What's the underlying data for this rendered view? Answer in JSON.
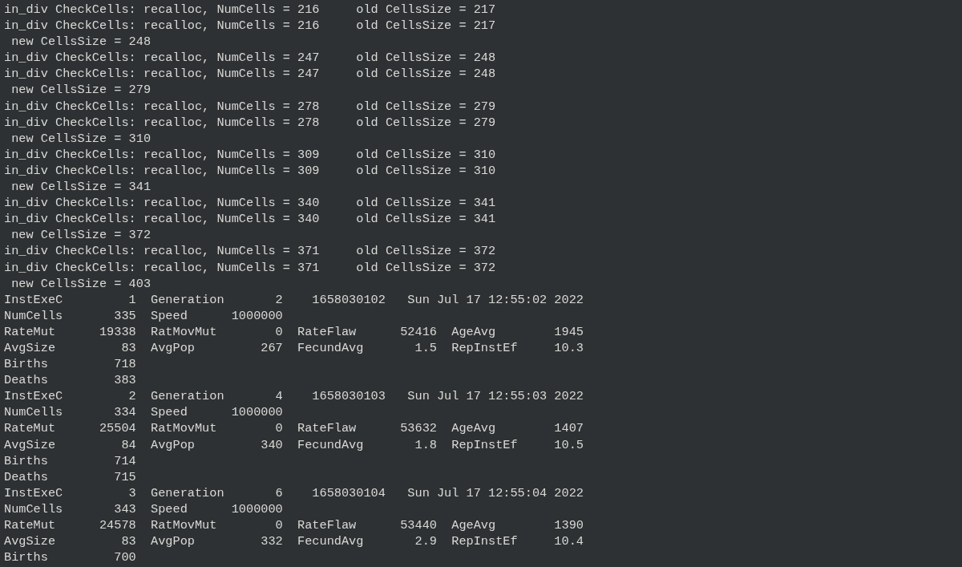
{
  "terminal": {
    "lines": [
      "in_div CheckCells: recalloc, NumCells = 216     old CellsSize = 217",
      "in_div CheckCells: recalloc, NumCells = 216     old CellsSize = 217",
      " new CellsSize = 248",
      "in_div CheckCells: recalloc, NumCells = 247     old CellsSize = 248",
      "in_div CheckCells: recalloc, NumCells = 247     old CellsSize = 248",
      " new CellsSize = 279",
      "in_div CheckCells: recalloc, NumCells = 278     old CellsSize = 279",
      "in_div CheckCells: recalloc, NumCells = 278     old CellsSize = 279",
      " new CellsSize = 310",
      "in_div CheckCells: recalloc, NumCells = 309     old CellsSize = 310",
      "in_div CheckCells: recalloc, NumCells = 309     old CellsSize = 310",
      " new CellsSize = 341",
      "in_div CheckCells: recalloc, NumCells = 340     old CellsSize = 341",
      "in_div CheckCells: recalloc, NumCells = 340     old CellsSize = 341",
      " new CellsSize = 372",
      "in_div CheckCells: recalloc, NumCells = 371     old CellsSize = 372",
      "in_div CheckCells: recalloc, NumCells = 371     old CellsSize = 372",
      " new CellsSize = 403",
      "InstExeC         1  Generation       2    1658030102   Sun Jul 17 12:55:02 2022",
      "NumCells       335  Speed      1000000",
      "RateMut      19338  RatMovMut        0  RateFlaw      52416  AgeAvg        1945",
      "AvgSize         83  AvgPop         267  FecundAvg       1.5  RepInstEf     10.3",
      "Births         718",
      "Deaths         383",
      "InstExeC         2  Generation       4    1658030103   Sun Jul 17 12:55:03 2022",
      "NumCells       334  Speed      1000000",
      "RateMut      25504  RatMovMut        0  RateFlaw      53632  AgeAvg        1407",
      "AvgSize         84  AvgPop         340  FecundAvg       1.8  RepInstEf     10.5",
      "Births         714",
      "Deaths         715",
      "InstExeC         3  Generation       6    1658030104   Sun Jul 17 12:55:04 2022",
      "NumCells       343  Speed      1000000",
      "RateMut      24578  RatMovMut        0  RateFlaw      53440  AgeAvg        1390",
      "AvgSize         83  AvgPop         332  FecundAvg       2.9  RepInstEf     10.4",
      "Births         700"
    ]
  }
}
